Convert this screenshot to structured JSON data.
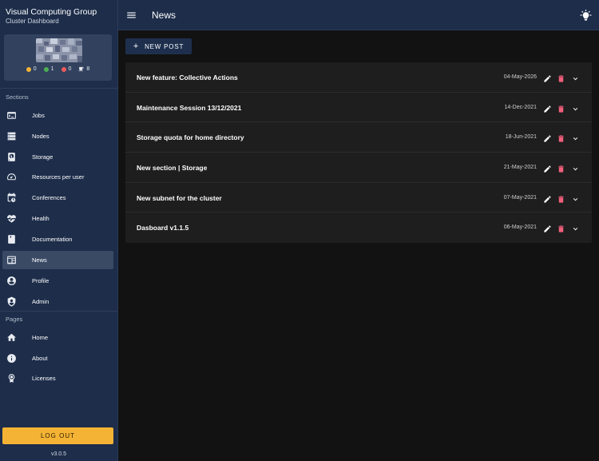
{
  "sidebar": {
    "title": "Visual Computing Group",
    "subtitle": "Cluster Dashboard",
    "stats": [
      {
        "value": "0",
        "color": "#f5b335"
      },
      {
        "value": "1",
        "color": "#4caf50"
      },
      {
        "value": "0",
        "color": "#f05a5a"
      },
      {
        "value": "8",
        "icon": "coffee-icon"
      }
    ],
    "sections_label": "Sections",
    "sections": [
      {
        "label": "Jobs",
        "icon": "terminal-icon"
      },
      {
        "label": "Nodes",
        "icon": "server-icon"
      },
      {
        "label": "Storage",
        "icon": "harddisk-icon"
      },
      {
        "label": "Resources per user",
        "icon": "speedometer-icon"
      },
      {
        "label": "Conferences",
        "icon": "calendar-clock-icon"
      },
      {
        "label": "Health",
        "icon": "heart-pulse-icon"
      },
      {
        "label": "Documentation",
        "icon": "book-icon"
      },
      {
        "label": "News",
        "icon": "newspaper-icon",
        "active": true
      },
      {
        "label": "Profile",
        "icon": "account-circle-icon"
      },
      {
        "label": "Admin",
        "icon": "shield-icon"
      }
    ],
    "pages_label": "Pages",
    "pages": [
      {
        "label": "Home",
        "icon": "home-icon"
      },
      {
        "label": "About",
        "icon": "info-icon"
      },
      {
        "label": "Licenses",
        "icon": "certificate-icon"
      }
    ],
    "logout_label": "LOG OUT",
    "version": "v3.0.5"
  },
  "topbar": {
    "title": "News",
    "menu_icon": "menu-icon",
    "theme_icon": "lightbulb-icon"
  },
  "main": {
    "new_post_label": "NEW POST",
    "news": [
      {
        "title": "New feature: Collective Actions",
        "date": "04-May-2026"
      },
      {
        "title": "Maintenance Session 13/12/2021",
        "date": "14-Dec-2021"
      },
      {
        "title": "Storage quota for home directory",
        "date": "18-Jun-2021"
      },
      {
        "title": "New section | Storage",
        "date": "21-May-2021"
      },
      {
        "title": "New subnet for the cluster",
        "date": "07-May-2021"
      },
      {
        "title": "Dasboard v1.1.5",
        "date": "06-May-2021"
      }
    ]
  },
  "colors": {
    "sidebar_bg": "#1d2d4a",
    "accent_logout": "#f5b335",
    "delete": "#ef5f7b"
  }
}
